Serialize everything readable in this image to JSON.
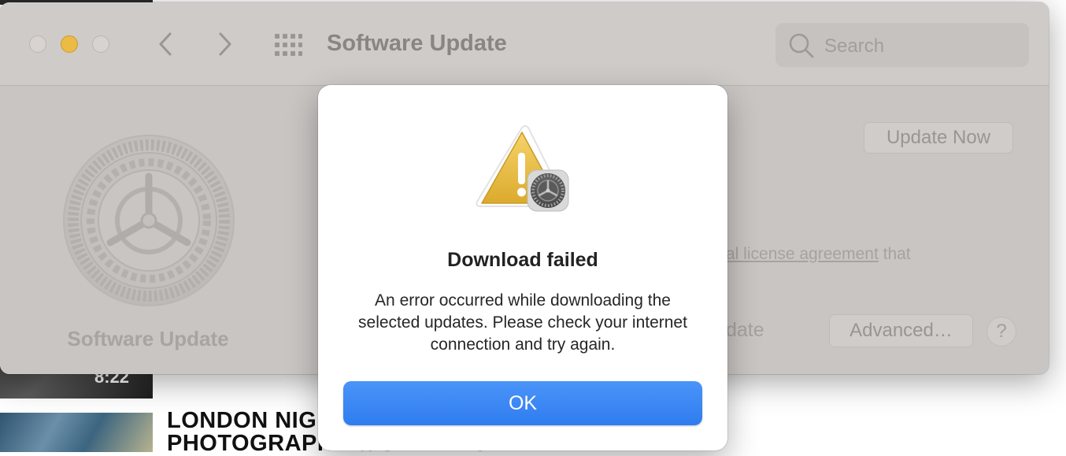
{
  "background": {
    "video_duration": "8:22",
    "article_title": "LONDON NIGHT PHOTOGRAPHY & STREETS"
  },
  "window": {
    "title": "Software Update",
    "search": {
      "placeholder": "Search"
    },
    "panel_label": "Software Update",
    "update_now_label": "Update Now",
    "license_link_text": "al license agreement",
    "license_suffix": " that",
    "date_fragment": "date",
    "advanced_label": "Advanced…",
    "help_label": "?"
  },
  "dialog": {
    "title": "Download failed",
    "message": "An error occurred while downloading the selected updates. Please check your internet connection and try again.",
    "ok_label": "OK",
    "icon": "warning-with-gear-icon"
  },
  "colors": {
    "accent": "#2f7cf0",
    "warning": "#ecbb45"
  }
}
